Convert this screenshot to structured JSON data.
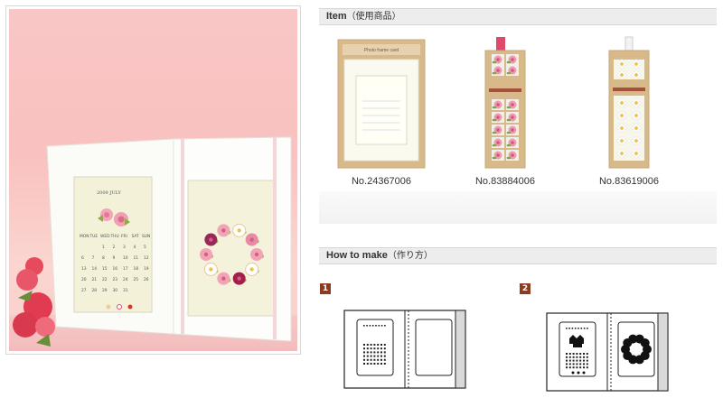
{
  "items_section": {
    "title_en": "Item",
    "title_jp": "（使用商品）"
  },
  "items": [
    {
      "code": "No.24367006",
      "package_text": "Photo frame card"
    },
    {
      "code": "No.83884006",
      "package_text": ""
    },
    {
      "code": "No.83619006",
      "package_text": ""
    }
  ],
  "howto_section": {
    "title_en": "How to make",
    "title_jp": "（作り方）"
  },
  "steps": [
    {
      "number": "1"
    },
    {
      "number": "2"
    }
  ],
  "photo": {
    "calendar_title": "2009 JULY",
    "weekdays": [
      "MON",
      "TUE",
      "WED",
      "THU",
      "FRI",
      "SAT",
      "SUN"
    ],
    "days": [
      "",
      "",
      "1",
      "2",
      "3",
      "4",
      "5",
      "6",
      "7",
      "8",
      "9",
      "10",
      "11",
      "12",
      "13",
      "14",
      "15",
      "16",
      "17",
      "18",
      "19",
      "20",
      "21",
      "22",
      "23",
      "24",
      "25",
      "26",
      "27",
      "28",
      "29",
      "30",
      "31",
      "",
      ""
    ]
  },
  "colors": {
    "step_badge": "#8b3b1f",
    "header_bg": "#ededed",
    "photo_bg": "#f7b4b4"
  }
}
